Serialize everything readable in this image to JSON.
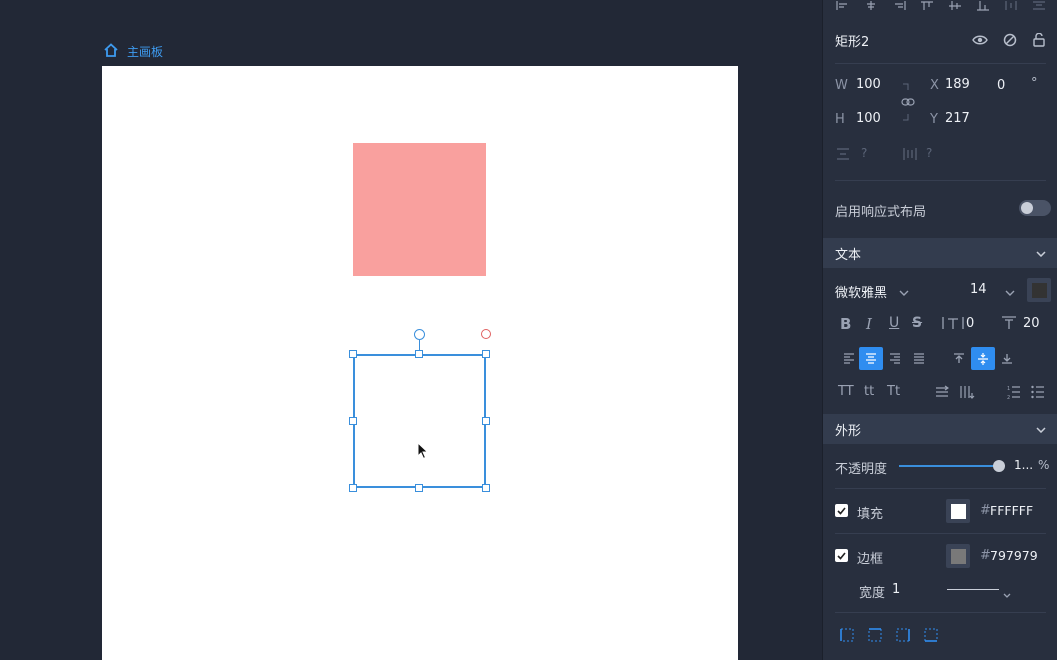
{
  "breadcrumb": {
    "label": "主画板"
  },
  "layer": {
    "name": "矩形2"
  },
  "geometry": {
    "w_label": "W",
    "w_value": "100",
    "h_label": "H",
    "h_value": "100",
    "x_label": "X",
    "x_value": "189",
    "y_label": "Y",
    "y_value": "217",
    "rotation_value": "0",
    "rotation_unit": "°",
    "spacing_v": "?",
    "spacing_h": "?"
  },
  "responsive": {
    "label": "启用响应式布局",
    "enabled": false
  },
  "text_section": {
    "title": "文本",
    "font_family": "微软雅黑",
    "font_size": "14",
    "bold": "B",
    "italic": "I",
    "underline": "U",
    "strike": "S",
    "letter_spacing": "0",
    "line_height": "20",
    "case_upper": "TT",
    "case_lower": "tt",
    "case_title": "Tt"
  },
  "shape_section": {
    "title": "外形",
    "opacity_label": "不透明度",
    "opacity_value": "1...",
    "opacity_unit": "%",
    "opacity_fraction": 1.0,
    "fill_label": "填充",
    "fill_hash": "#",
    "fill_value": "FFFFFF",
    "fill_color": "#FFFFFF",
    "border_label": "边框",
    "border_hash": "#",
    "border_value": "797979",
    "border_color": "#797979",
    "width_label": "宽度",
    "width_value": "1"
  },
  "colors": {
    "accent": "#2f8df0",
    "pink_rect": "#f9a09e"
  }
}
